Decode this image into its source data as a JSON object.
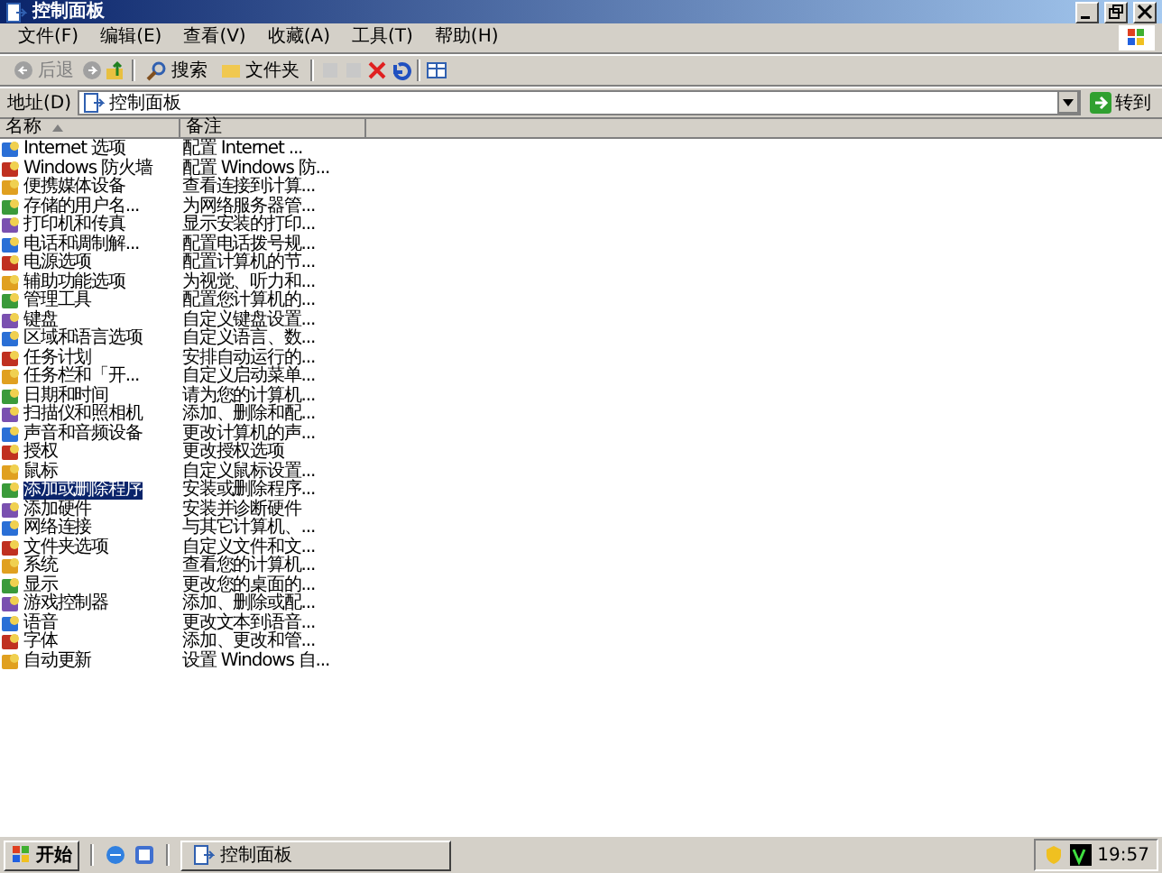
{
  "window": {
    "title": "控制面板"
  },
  "menu": [
    {
      "label": "文件(F)"
    },
    {
      "label": "编辑(E)"
    },
    {
      "label": "查看(V)"
    },
    {
      "label": "收藏(A)"
    },
    {
      "label": "工具(T)"
    },
    {
      "label": "帮助(H)"
    }
  ],
  "toolbar": {
    "back": {
      "label": "后退",
      "disabled": true
    },
    "search": {
      "label": "搜索"
    },
    "folders": {
      "label": "文件夹"
    }
  },
  "address": {
    "label": "地址(D)",
    "value": "控制面板",
    "go": "转到"
  },
  "columns": [
    {
      "label": "名称",
      "sorted": true
    },
    {
      "label": "备注",
      "sorted": false
    }
  ],
  "rows": [
    {
      "name": "Internet 选项",
      "comment": "配置 Internet ...",
      "selected": false
    },
    {
      "name": "Windows 防火墙",
      "comment": "配置 Windows 防...",
      "selected": false
    },
    {
      "name": "便携媒体设备",
      "comment": "查看连接到计算...",
      "selected": false
    },
    {
      "name": "存储的用户名...",
      "comment": "为网络服务器管...",
      "selected": false
    },
    {
      "name": "打印机和传真",
      "comment": "显示安装的打印...",
      "selected": false
    },
    {
      "name": "电话和调制解...",
      "comment": "配置电话拨号规...",
      "selected": false
    },
    {
      "name": "电源选项",
      "comment": "配置计算机的节...",
      "selected": false
    },
    {
      "name": "辅助功能选项",
      "comment": "为视觉、听力和...",
      "selected": false
    },
    {
      "name": "管理工具",
      "comment": "配置您计算机的...",
      "selected": false
    },
    {
      "name": "键盘",
      "comment": "自定义键盘设置...",
      "selected": false
    },
    {
      "name": "区域和语言选项",
      "comment": "自定义语言、数...",
      "selected": false
    },
    {
      "name": "任务计划",
      "comment": "安排自动运行的...",
      "selected": false
    },
    {
      "name": "任务栏和「开...",
      "comment": "自定义启动菜单...",
      "selected": false
    },
    {
      "name": "日期和时间",
      "comment": "请为您的计算机...",
      "selected": false
    },
    {
      "name": "扫描仪和照相机",
      "comment": "添加、删除和配...",
      "selected": false
    },
    {
      "name": "声音和音频设备",
      "comment": "更改计算机的声...",
      "selected": false
    },
    {
      "name": "授权",
      "comment": "更改授权选项",
      "selected": false
    },
    {
      "name": "鼠标",
      "comment": "自定义鼠标设置...",
      "selected": false
    },
    {
      "name": "添加或删除程序",
      "comment": "安装或删除程序...",
      "selected": true
    },
    {
      "name": "添加硬件",
      "comment": "安装并诊断硬件",
      "selected": false
    },
    {
      "name": "网络连接",
      "comment": "与其它计算机、...",
      "selected": false
    },
    {
      "name": "文件夹选项",
      "comment": "自定义文件和文...",
      "selected": false
    },
    {
      "name": "系统",
      "comment": "查看您的计算机...",
      "selected": false
    },
    {
      "name": "显示",
      "comment": "更改您的桌面的...",
      "selected": false
    },
    {
      "name": "游戏控制器",
      "comment": "添加、删除或配...",
      "selected": false
    },
    {
      "name": "语音",
      "comment": "更改文本到语音...",
      "selected": false
    },
    {
      "name": "字体",
      "comment": "添加、更改和管...",
      "selected": false
    },
    {
      "name": "自动更新",
      "comment": "设置 Windows 自...",
      "selected": false
    }
  ],
  "taskbar": {
    "start": "开始",
    "tasks": [
      {
        "label": "控制面板",
        "selected": false
      }
    ],
    "clock": "19:57"
  }
}
